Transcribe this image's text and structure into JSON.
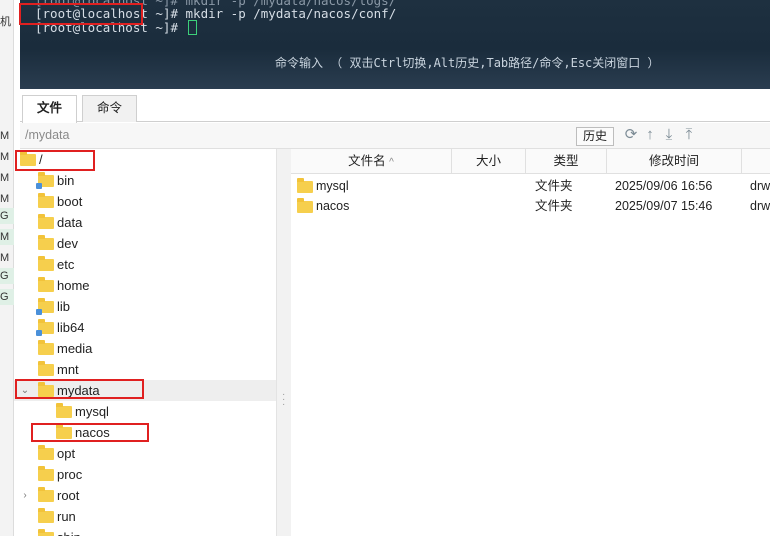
{
  "left_strip": {
    "items": [
      "机",
      "M",
      "M",
      "M",
      "M",
      "G",
      "M",
      "M",
      "G",
      "G"
    ]
  },
  "terminal": {
    "line0": "[root@localhost ~]# mkdir -p /mydata/nacos/logs/",
    "line1_prompt": "[root@localhost",
    "line1_cmd": " ~]# mkdir -p /mydata/nacos/conf/",
    "line2": "[root@localhost ~]# ",
    "hint": "命令输入 （ 双击Ctrl切换,Alt历史,Tab路径/命令,Esc关闭窗口 ）"
  },
  "tabs": [
    {
      "label": "文件",
      "active": true
    },
    {
      "label": "命令",
      "active": false
    }
  ],
  "pathbar": {
    "path": "/mydata",
    "history_label": "历史",
    "tool_icons": [
      "refresh-icon",
      "go-up-icon",
      "download-icon",
      "upload-icon"
    ]
  },
  "tree": {
    "root_label": "/",
    "items": [
      {
        "label": "bin",
        "link": true
      },
      {
        "label": "boot",
        "link": false
      },
      {
        "label": "data",
        "link": false
      },
      {
        "label": "dev",
        "link": false
      },
      {
        "label": "etc",
        "link": false
      },
      {
        "label": "home",
        "link": false
      },
      {
        "label": "lib",
        "link": true
      },
      {
        "label": "lib64",
        "link": true
      },
      {
        "label": "media",
        "link": false
      },
      {
        "label": "mnt",
        "link": false
      },
      {
        "label": "mydata",
        "link": false,
        "expanded": true
      },
      {
        "label": "mysql",
        "link": false,
        "child": true
      },
      {
        "label": "nacos",
        "link": false,
        "child": true
      },
      {
        "label": "opt",
        "link": false
      },
      {
        "label": "proc",
        "link": false
      },
      {
        "label": "root",
        "link": false,
        "collapsed": true
      },
      {
        "label": "run",
        "link": false
      },
      {
        "label": "sbin",
        "link": true
      }
    ]
  },
  "filelist": {
    "columns": {
      "name": "文件名",
      "size": "大小",
      "type": "类型",
      "mtime": "修改时间",
      "perm": ""
    },
    "rows": [
      {
        "name": "mysql",
        "size": "",
        "type": "文件夹",
        "mtime": "2025/09/06 16:56",
        "perm": "drwxr-xr-x"
      },
      {
        "name": "nacos",
        "size": "",
        "type": "文件夹",
        "mtime": "2025/09/07 15:46",
        "perm": "drwxr-xr-x"
      }
    ]
  },
  "colors": {
    "highlight_box": "#e02020",
    "folder": "#f6cf4d",
    "terminal_bg": "#1e3040"
  }
}
